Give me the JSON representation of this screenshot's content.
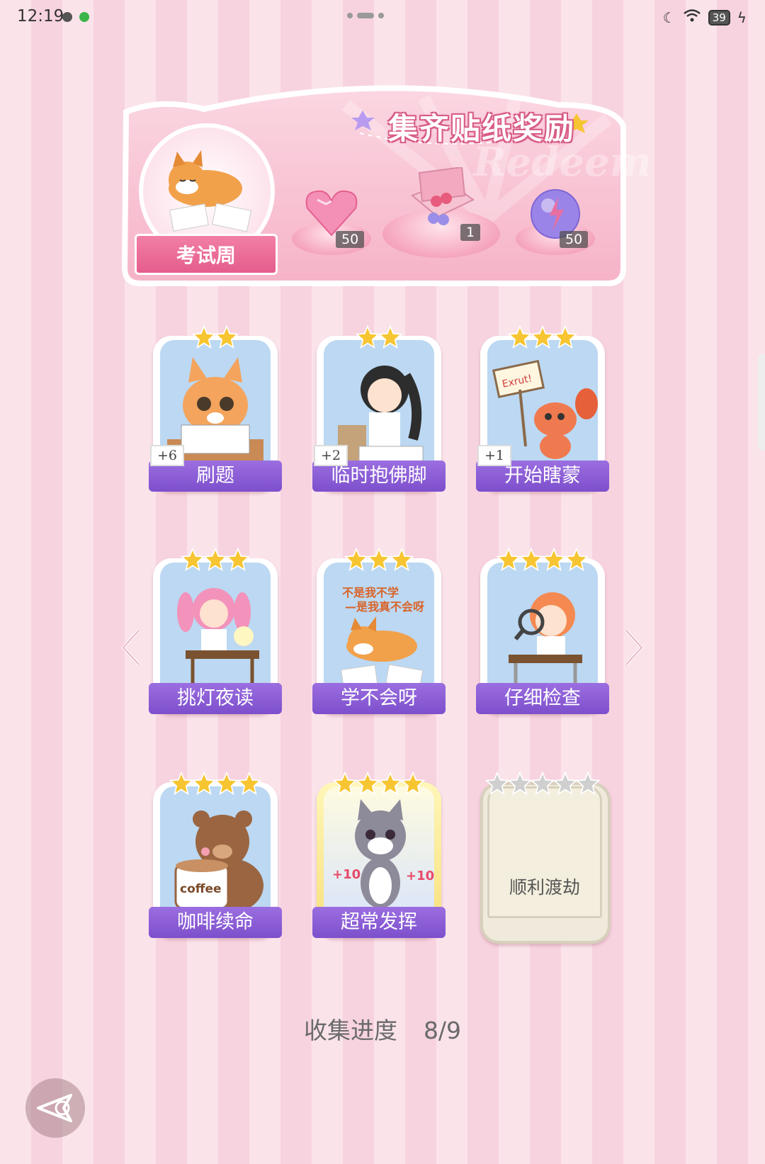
{
  "status_bar": {
    "time": "12:19",
    "battery": "39"
  },
  "banner": {
    "title": "集齐贴纸奖励",
    "watermark": "Redeem",
    "theme_label": "考试周",
    "rewards": [
      {
        "icon": "pink-heart-gem-icon",
        "qty": "50"
      },
      {
        "icon": "gift-box-icon",
        "qty": "1"
      },
      {
        "icon": "purple-orb-icon",
        "qty": "50"
      }
    ]
  },
  "cards": [
    {
      "label": "刷题",
      "stars": 2,
      "badge": "+6",
      "art": "cat-studying-icon"
    },
    {
      "label": "临时抱佛脚",
      "stars": 2,
      "badge": "+2",
      "art": "girl-praying-icon"
    },
    {
      "label": "开始瞎蒙",
      "stars": 3,
      "badge": "+1",
      "art": "lobster-sign-icon"
    },
    {
      "label": "挑灯夜读",
      "stars": 3,
      "badge": "",
      "art": "girl-reading-icon"
    },
    {
      "label": "学不会呀",
      "stars": 3,
      "badge": "",
      "art": "shiba-tired-icon"
    },
    {
      "label": "仔细检查",
      "stars": 4,
      "badge": "",
      "art": "girl-magnifier-icon"
    },
    {
      "label": "咖啡续命",
      "stars": 4,
      "badge": "",
      "art": "bear-coffee-icon"
    },
    {
      "label": "超常发挥",
      "stars": 4,
      "badge": "",
      "art": "cat-pencils-icon"
    },
    {
      "label": "顺利渡劫",
      "stars": 5,
      "badge": "",
      "art": "locked-card-icon"
    }
  ],
  "progress": {
    "label": "收集进度",
    "value": "8/9"
  },
  "colors": {
    "accent_purple": "#8a5bd6",
    "pink": "#f27fa5",
    "star_gold": "#f7c531",
    "star_gray": "#cfcfcf"
  }
}
